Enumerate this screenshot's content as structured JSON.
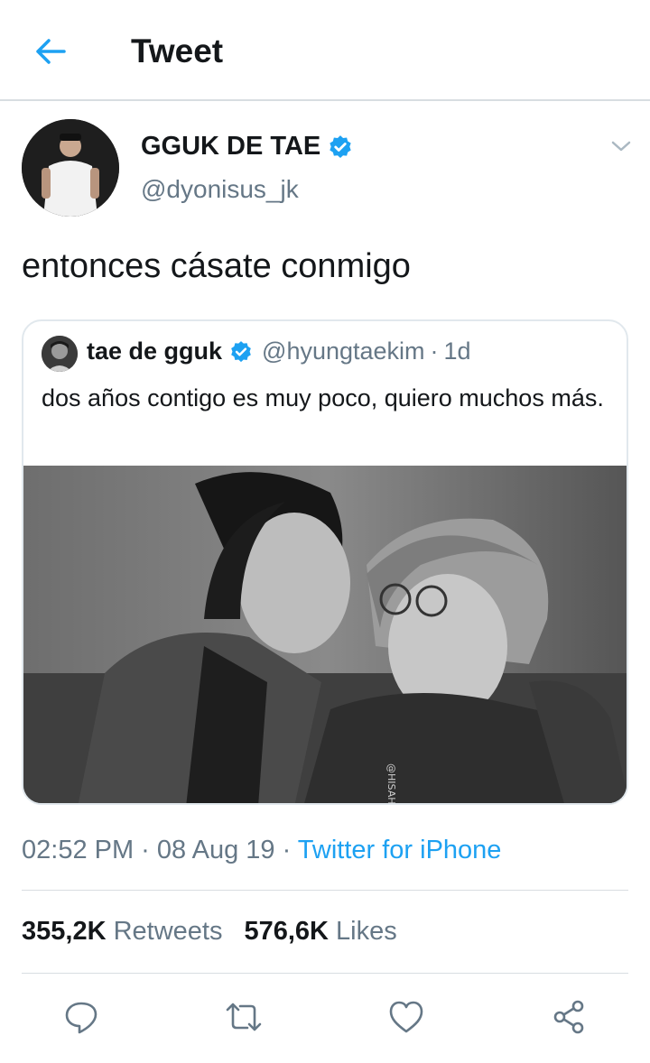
{
  "header": {
    "title": "Tweet",
    "back_icon": "arrow-left-icon"
  },
  "tweet": {
    "display_name": "GGUK DE TAE",
    "handle": "@dyonisus_jk",
    "verified_icon": "verified-badge-icon",
    "text": "entonces cásate conmigo",
    "timestamp": "02:52 PM · 08 Aug 19 · ",
    "source": "Twitter for iPhone"
  },
  "quote": {
    "display_name": "tae de gguk",
    "handle": "@hyungtaekim",
    "meta_sep": "·",
    "time": "1d",
    "text": "dos años contigo es muy poco, quiero muchos más.",
    "watermark": "@HISAH7HUN"
  },
  "stats": {
    "retweets_count": "355,2K",
    "retweets_label": "Retweets",
    "likes_count": "576,6K",
    "likes_label": "Likes"
  },
  "colors": {
    "accent": "#1da1f2",
    "secondary_text": "#657786",
    "divider": "#d8dde1"
  }
}
